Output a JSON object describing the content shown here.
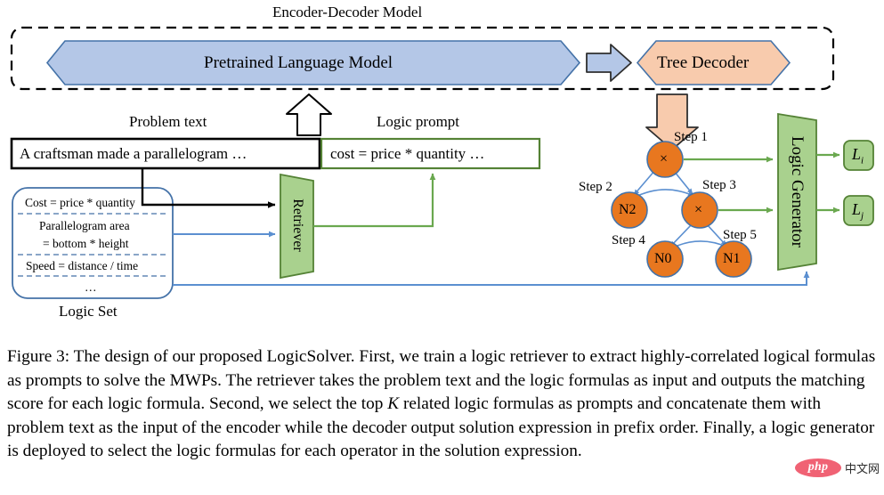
{
  "figure": {
    "encoder_decoder_title": "Encoder-Decoder Model",
    "plm_label": "Pretrained Language Model",
    "tree_decoder_label": "Tree Decoder",
    "problem_text_label": "Problem text",
    "logic_prompt_label": "Logic prompt",
    "problem_text_value": "A craftsman made a parallelogram …",
    "logic_prompt_value": "cost = price * quantity …",
    "retriever_label": "Retriever",
    "logic_generator_label": "Logic Generator",
    "logic_set_caption": "Logic Set",
    "logic_set_items": [
      "Cost = price  * quantity",
      "Parallelogram area\n= bottom * height",
      "Speed = distance / time",
      "…"
    ],
    "logic_set_item_1_line1": "Parallelogram area",
    "logic_set_item_1_line2": "= bottom * height",
    "tree": {
      "nodes": [
        {
          "id": "root",
          "label": "×",
          "step": "Step 1"
        },
        {
          "id": "n2",
          "label": "N2",
          "step": "Step 2"
        },
        {
          "id": "mid",
          "label": "×",
          "step": "Step 3"
        },
        {
          "id": "n0",
          "label": "N0",
          "step": "Step 4"
        },
        {
          "id": "n1",
          "label": "N1",
          "step": "Step 5"
        }
      ]
    },
    "outputs": [
      {
        "base": "L",
        "sub": "i"
      },
      {
        "base": "L",
        "sub": "j"
      }
    ]
  },
  "caption": {
    "prefix": "Figure 3:",
    "part1": " The design of our proposed LogicSolver. First, we train a logic retriever to extract highly-correlated logical formulas as prompts to solve the MWPs. The retriever takes the problem text and the logic formulas as input and outputs the matching score for each logic formula. Second, we select the top ",
    "k": "K",
    "part2": " related logic formulas as prompts and concatenate them with problem text as the input of the encoder while the decoder output solution expression in prefix order. Finally, a logic generator is deployed to select the logic formulas for each operator in the solution expression."
  },
  "watermark": {
    "brand": "php",
    "cn": "中文网"
  },
  "colors": {
    "blue_fill": "#b4c7e7",
    "blue_stroke": "#4472a8",
    "orange_fill": "#f8cbad",
    "orange_node": "#e8771f",
    "green_fill": "#a9d18e",
    "green_stroke": "#548235",
    "green_arrow": "#6aa84f",
    "black": "#000000",
    "watermark_pill": "#f06274"
  }
}
